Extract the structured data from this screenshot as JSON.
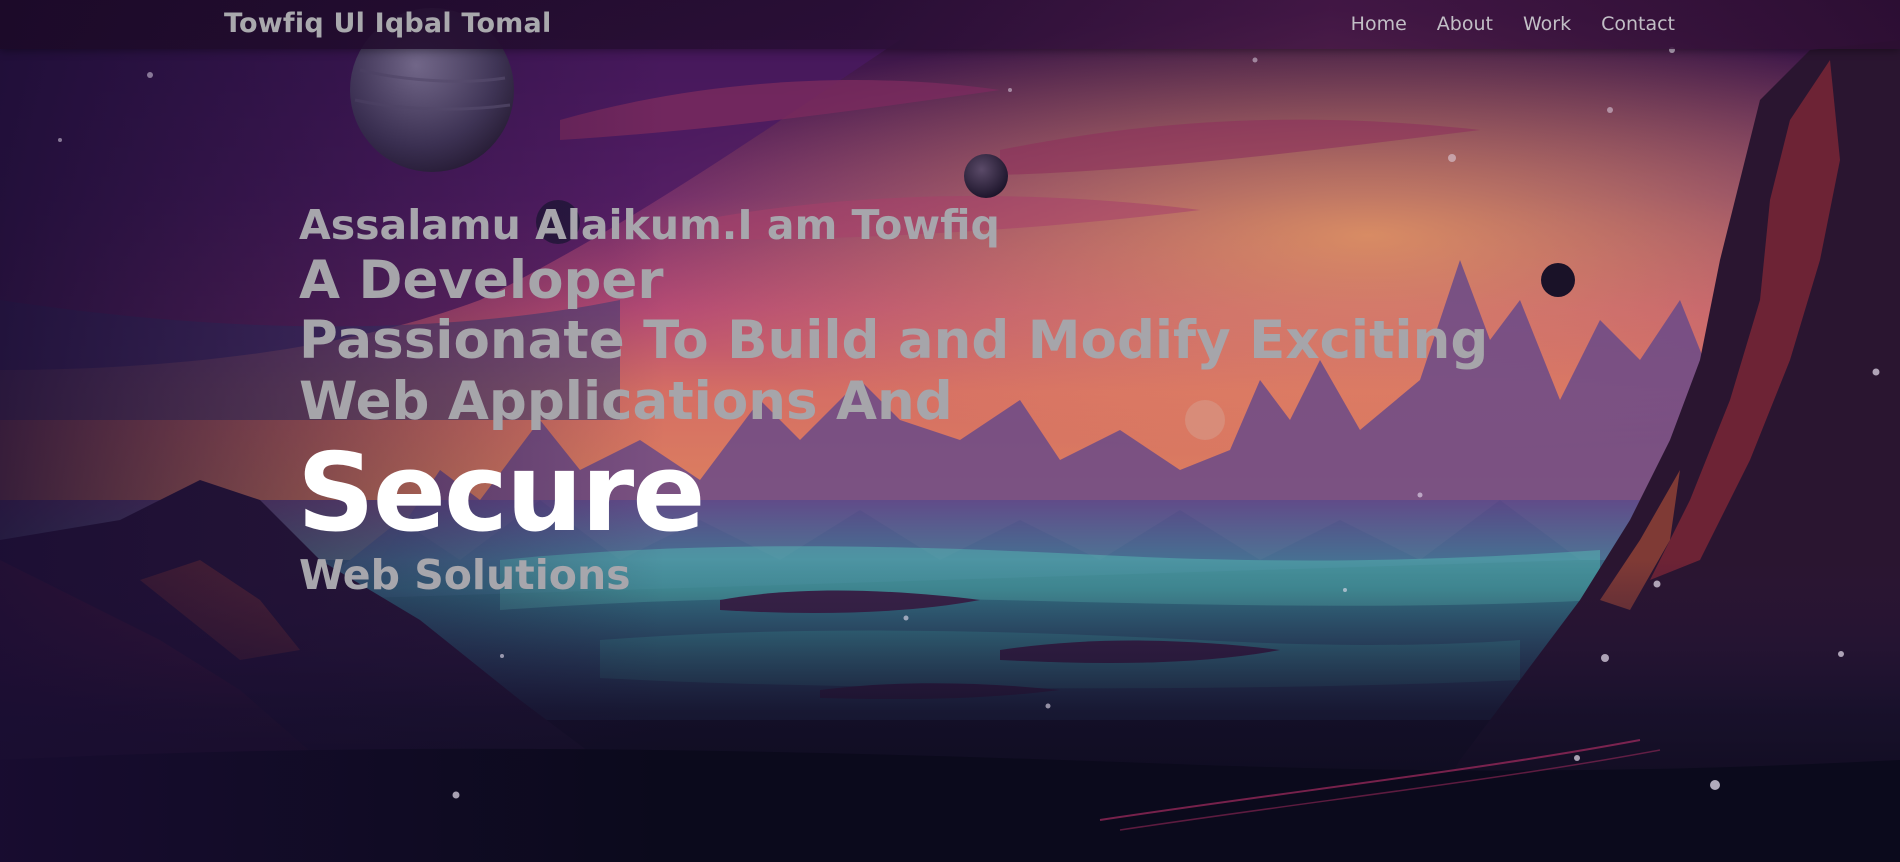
{
  "navbar": {
    "brand": "Towfiq Ul Iqbal Tomal",
    "links": [
      {
        "label": "Home"
      },
      {
        "label": "About"
      },
      {
        "label": "Work"
      },
      {
        "label": "Contact"
      }
    ]
  },
  "hero": {
    "greeting": "Assalamu Alaikum.I am Towfiq",
    "role": "A Developer",
    "tagline": "Passionate To Build and Modify Exciting Web Applications And",
    "emphasis": "Secure",
    "subtitle": "Web Solutions"
  },
  "colors": {
    "sky_top": "#3a1448",
    "sky_mid": "#9c3a78",
    "horizon": "#e07a5a",
    "water": "#3fb3b0",
    "ground": "#0b0a1c"
  },
  "background": {
    "icons": [
      "planet-icon",
      "moon-icon",
      "star-icon"
    ]
  }
}
